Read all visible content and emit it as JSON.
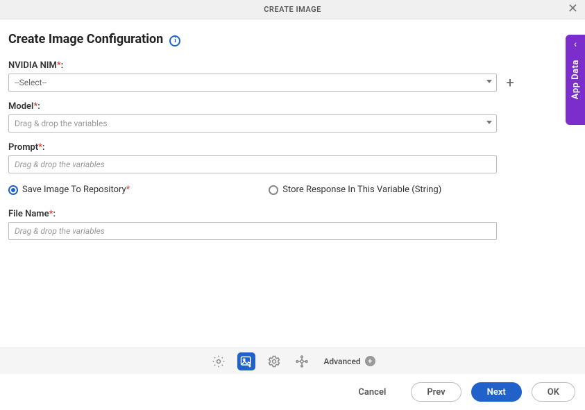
{
  "modal": {
    "title": "CREATE IMAGE",
    "close_icon": "✕"
  },
  "heading": "Create Image Configuration",
  "info_glyph": "i",
  "fields": {
    "nim": {
      "label": "NVIDIA NIM",
      "colon": ":",
      "selected": "--Select--"
    },
    "model": {
      "label": "Model",
      "colon": ":",
      "placeholder": "Drag & drop the variables"
    },
    "prompt": {
      "label": "Prompt",
      "colon": ":",
      "placeholder": "Drag & drop the variables"
    },
    "filename": {
      "label": "File Name",
      "colon": ":",
      "placeholder": "Drag & drop the variables"
    }
  },
  "radios": {
    "save": "Save Image To Repository",
    "store": "Store Response In This Variable (String)",
    "req": "*"
  },
  "side_tab": {
    "chevron": "‹",
    "label": "App Data"
  },
  "footer": {
    "advanced": "Advanced",
    "plus": "+"
  },
  "buttons": {
    "cancel": "Cancel",
    "prev": "Prev",
    "next": "Next",
    "ok": "OK"
  }
}
